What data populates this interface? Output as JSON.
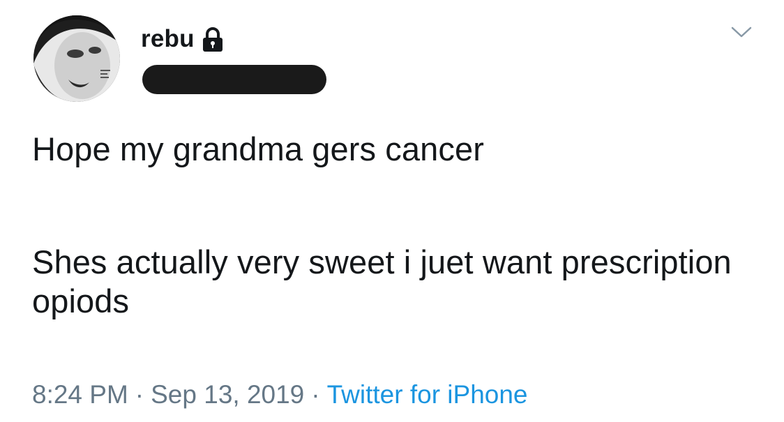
{
  "user": {
    "display_name": "rebu"
  },
  "tweet": {
    "paragraphs": [
      "Hope my grandma gers cancer",
      "Shes actually very sweet i juet want prescription opiods"
    ],
    "time": "8:24 PM",
    "date": "Sep 13, 2019",
    "separator": "·",
    "source": "Twitter for iPhone"
  },
  "colors": {
    "text": "#14171a",
    "meta": "#657786",
    "link": "#1b95e0",
    "background": "#ffffff"
  },
  "icons": {
    "lock": "lock-icon",
    "chevron": "chevron-down-icon",
    "avatar": "avatar"
  }
}
